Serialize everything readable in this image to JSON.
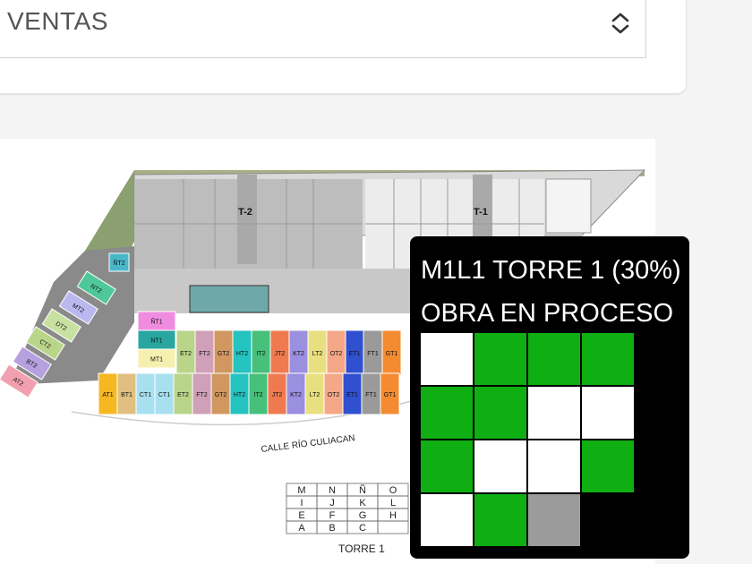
{
  "select": {
    "value": "VENTAS",
    "icon": "chevron-up-down-icon"
  },
  "plan": {
    "street_label": "CALLE RÍO CULIACAN",
    "tower_labels": [
      "T-2",
      "T-1"
    ],
    "upper_units": [
      {
        "label": "ÑT1",
        "color": "#f08ce0"
      },
      {
        "label": "NT1",
        "color": "#2aa6a0"
      },
      {
        "label": "MT1",
        "color": "#f5f0b0"
      }
    ],
    "diagonal_units": [
      {
        "label": "ÑT2",
        "color": "#4ab7c8"
      },
      {
        "label": "NT2",
        "color": "#4fc79a"
      },
      {
        "label": "MT2",
        "color": "#b9b9f0"
      },
      {
        "label": "DT2",
        "color": "#c8e1a0"
      },
      {
        "label": "CT2",
        "color": "#b9d58a"
      },
      {
        "label": "BT2",
        "color": "#b7a0e0"
      },
      {
        "label": "AT2",
        "color": "#f2a0b0"
      }
    ],
    "row_top": [
      {
        "label": "ET2",
        "color": "#b9d58a"
      },
      {
        "label": "FT2",
        "color": "#d0a0b8"
      },
      {
        "label": "GT2",
        "color": "#d09860"
      },
      {
        "label": "HT2",
        "color": "#24c3c0"
      },
      {
        "label": "IT2",
        "color": "#46c07a"
      },
      {
        "label": "JT2",
        "color": "#f07a50"
      },
      {
        "label": "KT2",
        "color": "#9b8fe0"
      },
      {
        "label": "LT2",
        "color": "#e8e080"
      },
      {
        "label": "OT2",
        "color": "#f5a888"
      },
      {
        "label": "ET1",
        "color": "#3050d0"
      },
      {
        "label": "FT1",
        "color": "#9a9a9a"
      },
      {
        "label": "GT1",
        "color": "#f58b30"
      }
    ],
    "row_bottom": [
      {
        "label": "AT1",
        "color": "#f5b820"
      },
      {
        "label": "BT1",
        "color": "#e0c080"
      },
      {
        "label": "CT1",
        "color": "#a8e0f0"
      },
      {
        "label": "CT1",
        "color": "#a8e0f0"
      },
      {
        "label": "ET2",
        "color": "#b9d58a"
      },
      {
        "label": "FT2",
        "color": "#d0a0b8"
      },
      {
        "label": "GT2",
        "color": "#d09860"
      },
      {
        "label": "HT2",
        "color": "#24c3c0"
      },
      {
        "label": "IT2",
        "color": "#46c07a"
      },
      {
        "label": "JT2",
        "color": "#f07a50"
      },
      {
        "label": "KT2",
        "color": "#9b8fe0"
      },
      {
        "label": "LT2",
        "color": "#e8e080"
      },
      {
        "label": "OT2",
        "color": "#f5a888"
      },
      {
        "label": "ET1",
        "color": "#3050d0"
      },
      {
        "label": "FT1",
        "color": "#9a9a9a"
      },
      {
        "label": "GT1",
        "color": "#f58b30"
      }
    ],
    "legend_rows": [
      [
        "M",
        "N",
        "Ñ",
        "O"
      ],
      [
        "I",
        "J",
        "K",
        "L"
      ],
      [
        "E",
        "F",
        "G",
        "H"
      ],
      [
        "A",
        "B",
        "C",
        ""
      ]
    ],
    "legend_caption": "TORRE 1"
  },
  "overlay": {
    "title": "M1L1 TORRE 1 (30%)",
    "status": "OBRA EN PROCESO",
    "grid": [
      [
        "white",
        "green",
        "green",
        "green"
      ],
      [
        "green",
        "green",
        "white",
        "white"
      ],
      [
        "green",
        "white",
        "white",
        "green"
      ],
      [
        "white",
        "green",
        "gray",
        "black"
      ]
    ]
  }
}
